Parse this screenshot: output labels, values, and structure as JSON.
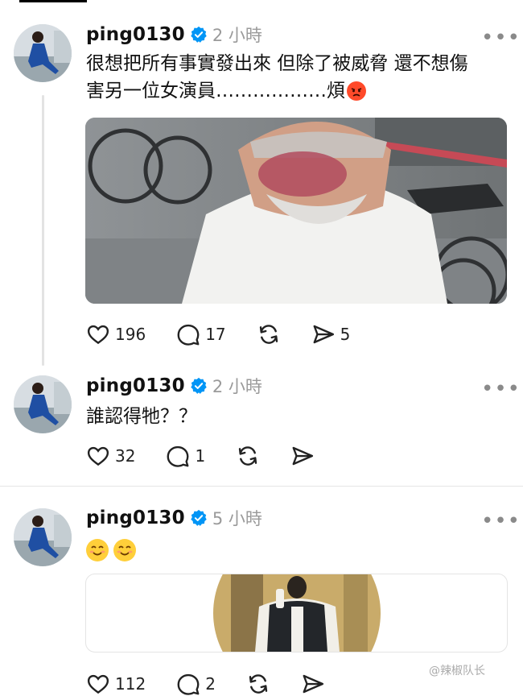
{
  "posts": [
    {
      "username": "ping0130",
      "time": "2 小時",
      "text_lines": [
        "很想把所有事實發出來 但除了被威脅 還不想傷",
        "害另一位女演員………………煩"
      ],
      "likes": "196",
      "replies": "17",
      "shares": "5"
    },
    {
      "username": "ping0130",
      "time": "2 小時",
      "text": "誰認得牠？？",
      "likes": "32",
      "replies": "1"
    },
    {
      "username": "ping0130",
      "time": "5 小時",
      "likes": "112",
      "replies": "2"
    }
  ],
  "icons": [
    "verified-badge-icon",
    "more-icon",
    "heart-icon",
    "comment-icon",
    "repost-icon",
    "share-icon",
    "angry-emoji-icon",
    "smile-emoji-icon"
  ],
  "colors": {
    "verified": "#0095f6",
    "text": "#111111",
    "muted": "#9a9a9a"
  },
  "watermark": "@辣椒队长"
}
